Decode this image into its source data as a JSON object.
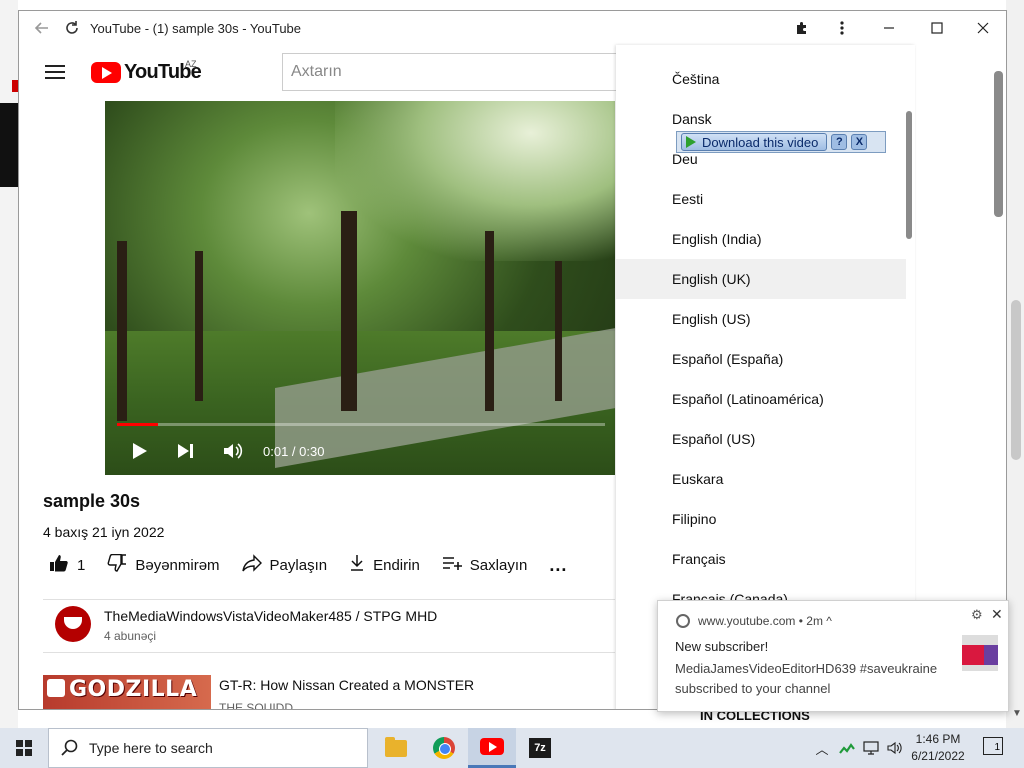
{
  "window": {
    "title": "YouTube - (1) sample 30s - YouTube",
    "icons": [
      "back-arrow-icon",
      "reload-icon",
      "extensions-icon",
      "kebab-menu-icon",
      "minimize-icon",
      "maximize-icon",
      "close-icon"
    ]
  },
  "header": {
    "logo_text": "YouTube",
    "country_code": "AZ",
    "search_placeholder": "Axtarın"
  },
  "player": {
    "time": "0:01 / 0:30",
    "progress": 0.085
  },
  "video": {
    "title": "sample 30s",
    "meta": "4 baxış  21 iyn 2022",
    "like_count": "1",
    "dislike_label": "Bəyənmirəm",
    "share_label": "Paylaşın",
    "download_label": "Endirin",
    "save_label": "Saxlayın",
    "more_label": "..."
  },
  "channel": {
    "name": "TheMediaWindowsVistaVideoMaker485 / STPG MHD",
    "subscribers": "4 abunəçi"
  },
  "recommendation": {
    "thumb_text": "GODZILLA",
    "title": "GT-R: How Nissan Created a MONSTER",
    "channel": "THE SQUIDD"
  },
  "languages": {
    "items": [
      "Čeština",
      "Dansk",
      "Deu",
      "Eesti",
      "English (India)",
      "English (UK)",
      "English (US)",
      "Español (España)",
      "Español (Latinoamérica)",
      "Español (US)",
      "Euskara",
      "Filipino",
      "Français",
      "Français (Canada)"
    ],
    "selected": "English (UK)"
  },
  "download_helper": {
    "label": "Download this video",
    "help": "?",
    "close": "X"
  },
  "notification": {
    "site": "www.youtube.com",
    "age": "2m",
    "title": "New subscriber!",
    "line1": "MediaJamesVideoEditorHD639 #saveukraine",
    "line2": "subscribed to your channel"
  },
  "behind_text": "IN COLLECTIONS",
  "taskbar": {
    "search_placeholder": "Type here to search",
    "time": "1:46 PM",
    "date": "6/21/2022",
    "notif_count": "1"
  }
}
